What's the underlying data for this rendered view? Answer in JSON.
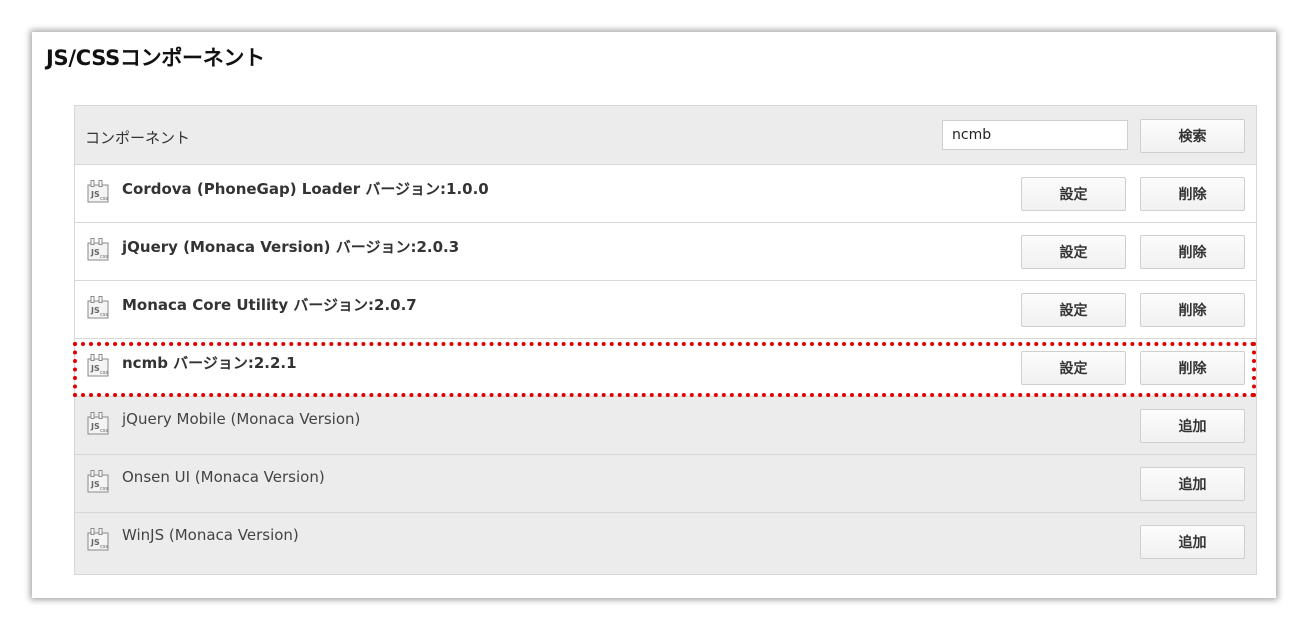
{
  "header": {
    "title": "JS/CSSコンポーネント"
  },
  "panel": {
    "label": "コンポーネント",
    "search": {
      "value": "ncmb"
    },
    "search_button": "検索"
  },
  "installed": [
    {
      "name": "Cordova (PhoneGap) Loader バージョン:1.0.0",
      "settings_label": "設定",
      "delete_label": "削除"
    },
    {
      "name": "jQuery (Monaca Version) バージョン:2.0.3",
      "settings_label": "設定",
      "delete_label": "削除"
    },
    {
      "name": "Monaca Core Utility バージョン:2.0.7",
      "settings_label": "設定",
      "delete_label": "削除"
    },
    {
      "name": "ncmb バージョン:2.2.1",
      "settings_label": "設定",
      "delete_label": "削除"
    }
  ],
  "available": [
    {
      "name": "jQuery Mobile (Monaca Version)",
      "add_label": "追加"
    },
    {
      "name": "Onsen UI (Monaca Version)",
      "add_label": "追加"
    },
    {
      "name": "WinJS (Monaca Version)",
      "add_label": "追加"
    }
  ],
  "icons": {
    "component": "js-css-file-icon"
  },
  "colors": {
    "highlight": "#e00000"
  }
}
